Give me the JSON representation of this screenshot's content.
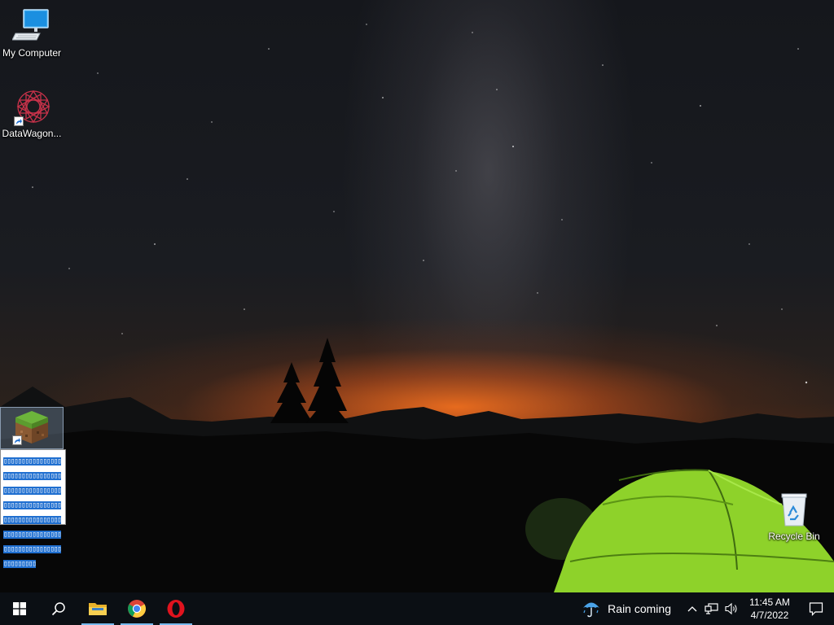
{
  "desktop": {
    "icons": [
      {
        "label": "My Computer",
        "icon": "computer-icon"
      },
      {
        "label": "DataWagon...",
        "icon": "datawagon-icon"
      },
      {
        "label": "Recycle Bin",
        "icon": "recycle-bin-icon"
      }
    ],
    "selected_icon": {
      "icon": "minecraft-grass-block-icon"
    },
    "rename_text": "▯▯▯▯▯▯▯▯▯▯▯▯▯▯▯▯▯▯▯▯▯▯▯▯▯▯▯▯▯▯▯▯▯▯▯▯▯▯▯▯▯▯▯▯▯▯▯▯▯▯▯▯▯▯▯▯▯▯▯▯▯▯▯▯▯▯▯▯▯▯▯▯▯▯▯▯▯▯▯▯▯▯▯▯▯▯▯▯▯▯▯▯▯▯▯▯▯▯▯▯▯▯▯▯▯▯▯▯▯▯▯▯▯▯▯▯▯▯▯▯▯"
  },
  "taskbar": {
    "start_icon": "windows-logo-icon",
    "search_icon": "search-icon",
    "pinned": [
      {
        "name": "file-explorer",
        "icon": "folder-icon",
        "active": true
      },
      {
        "name": "chrome",
        "icon": "chrome-icon",
        "active": true
      },
      {
        "name": "opera",
        "icon": "opera-icon",
        "active": true
      }
    ],
    "weather": {
      "text": "Rain coming",
      "icon": "umbrella-icon"
    },
    "clock": {
      "time": "11:45 AM",
      "date": "4/7/2022"
    },
    "accent_color": "#76b9ed"
  }
}
